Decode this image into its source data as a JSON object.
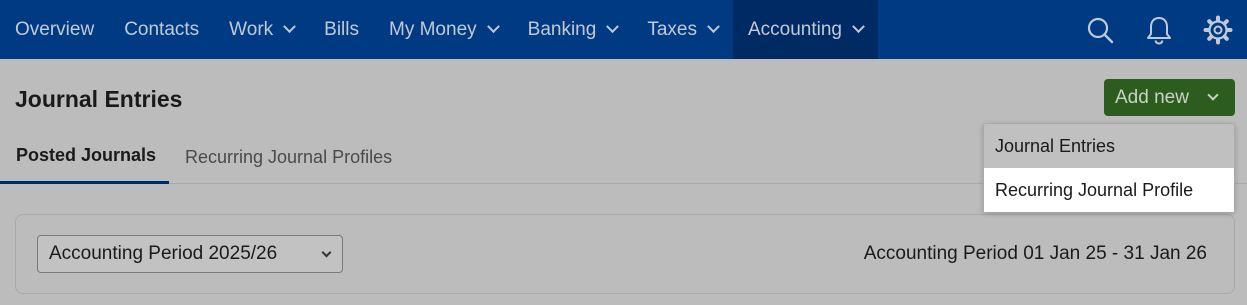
{
  "nav": {
    "items": [
      {
        "label": "Overview",
        "dropdown": false,
        "active": false
      },
      {
        "label": "Contacts",
        "dropdown": false,
        "active": false
      },
      {
        "label": "Work",
        "dropdown": true,
        "active": false
      },
      {
        "label": "Bills",
        "dropdown": false,
        "active": false
      },
      {
        "label": "My Money",
        "dropdown": true,
        "active": false
      },
      {
        "label": "Banking",
        "dropdown": true,
        "active": false
      },
      {
        "label": "Taxes",
        "dropdown": true,
        "active": false
      },
      {
        "label": "Accounting",
        "dropdown": true,
        "active": true
      }
    ],
    "icons": [
      "search-icon",
      "bell-icon",
      "gear-icon"
    ]
  },
  "page": {
    "title": "Journal Entries"
  },
  "add_button": {
    "label": "Add new"
  },
  "tabs": [
    {
      "label": "Posted Journals",
      "active": true
    },
    {
      "label": "Recurring Journal Profiles",
      "active": false
    }
  ],
  "add_menu": {
    "items": [
      {
        "label": "Journal Entries",
        "highlighted": false
      },
      {
        "label": "Recurring Journal Profile",
        "highlighted": true
      }
    ]
  },
  "filters": {
    "period_select_value": "Accounting Period 2025/26",
    "period_range_text": "Accounting Period 01 Jan 25 - 31 Jan 26"
  },
  "colors": {
    "nav_bg": "#003a82",
    "nav_active_bg": "#002a63",
    "add_button_bg": "#2c5d1f",
    "overlay_bg": "#bcbcbc",
    "menu_highlight": "#ffffff"
  }
}
